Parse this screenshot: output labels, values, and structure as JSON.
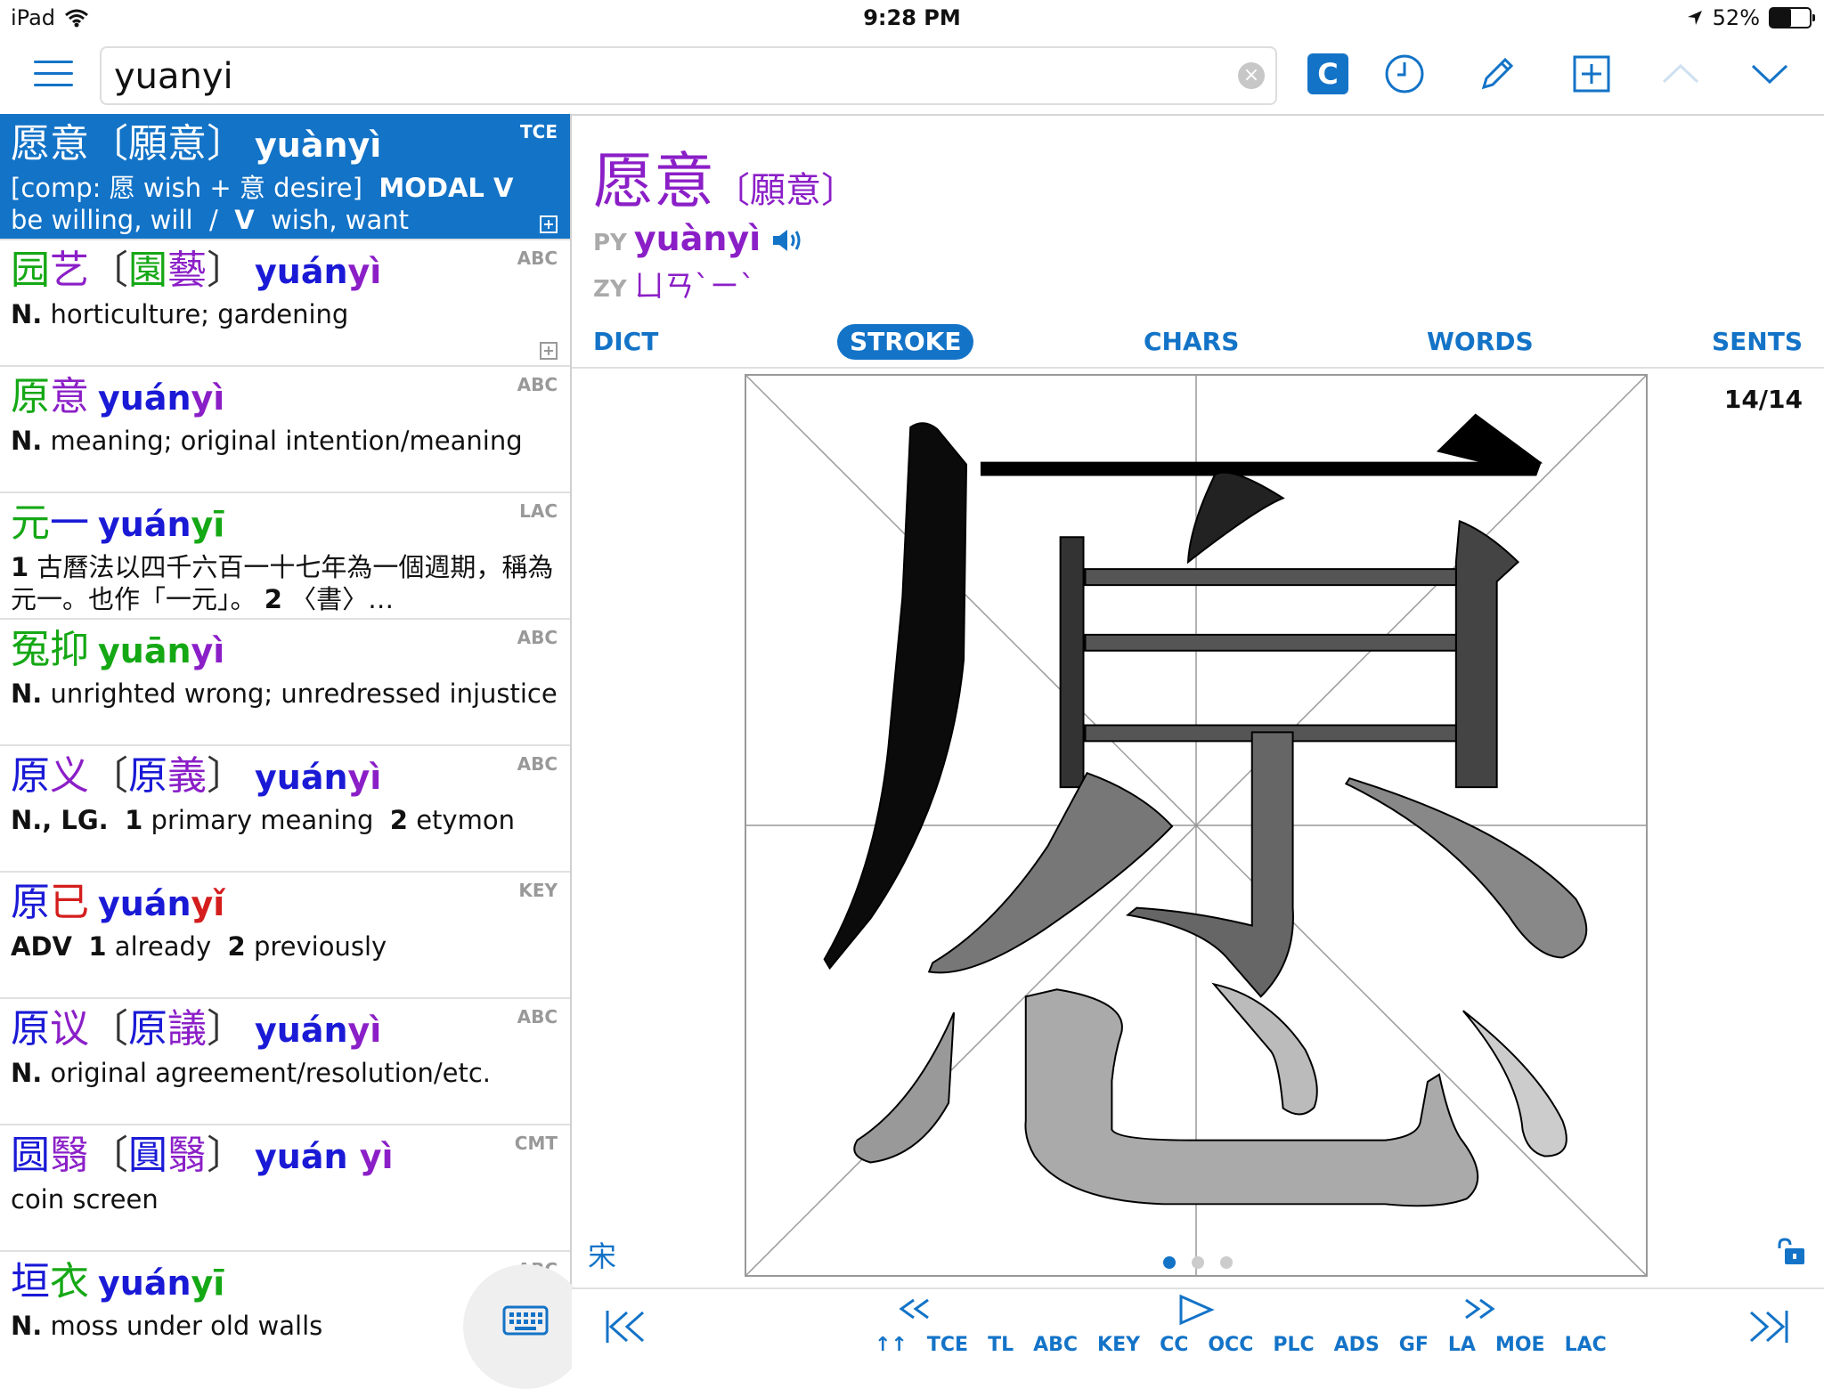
{
  "status": {
    "device": "iPad",
    "time": "9:28 PM",
    "battery": "52%",
    "battery_level": 0.52
  },
  "search": {
    "value": "yuanyi"
  },
  "toolbar": {
    "c_label": "C"
  },
  "results": [
    {
      "hanzi": [
        {
          "t": "愿意",
          "tone": "t4"
        },
        {
          "t": "〔願意〕",
          "tone": "t4"
        }
      ],
      "pinyin": [
        {
          "t": "yuànyì",
          "tone": "t4"
        }
      ],
      "source": "TCE",
      "def_html": "[comp: 愿 wish + 意 desire]&nbsp; <b>MODAL V</b>&nbsp; be willing, will&nbsp; /&nbsp; <b>V</b>&nbsp; wish, want",
      "selected": true
    },
    {
      "hanzi": [
        {
          "t": "园",
          "tone": "t2"
        },
        {
          "t": "艺",
          "tone": "t4"
        },
        {
          "t": "〔",
          "tone": "t5"
        },
        {
          "t": "園",
          "tone": "t2"
        },
        {
          "t": "藝",
          "tone": "t4"
        },
        {
          "t": "〕",
          "tone": "t5"
        }
      ],
      "pinyin": [
        {
          "t": "yuán",
          "tone": "t1"
        },
        {
          "t": "yì",
          "tone": "t4"
        }
      ],
      "source": "ABC",
      "def_html": "<b>N.</b> horticulture; gardening"
    },
    {
      "hanzi": [
        {
          "t": "原",
          "tone": "t2"
        },
        {
          "t": "意",
          "tone": "t4"
        }
      ],
      "pinyin": [
        {
          "t": "yuán",
          "tone": "t1"
        },
        {
          "t": "yì",
          "tone": "t4"
        }
      ],
      "source": "ABC",
      "def_html": "<b>N.</b> meaning; original intention/meaning"
    },
    {
      "hanzi": [
        {
          "t": "元",
          "tone": "t2"
        },
        {
          "t": "一",
          "tone": "t1"
        }
      ],
      "pinyin": [
        {
          "t": "yuán",
          "tone": "t1"
        },
        {
          "t": "yī",
          "tone": "t2"
        }
      ],
      "source": "LAC",
      "def_html": "<b>1</b> 古曆法以四千六百一十七年為一個週期，稱為元一。也作「一元」。 <b>2</b> 〈書〉…"
    },
    {
      "hanzi": [
        {
          "t": "冤",
          "tone": "t2"
        },
        {
          "t": "抑",
          "tone": "t2"
        }
      ],
      "pinyin": [
        {
          "t": "yuān",
          "tone": "t2"
        },
        {
          "t": "yì",
          "tone": "t4"
        }
      ],
      "source": "ABC",
      "def_html": "<b>N.</b> unrighted wrong; unredressed injustice"
    },
    {
      "hanzi": [
        {
          "t": "原",
          "tone": "t1"
        },
        {
          "t": "义",
          "tone": "t4"
        },
        {
          "t": "〔",
          "tone": "t5"
        },
        {
          "t": "原",
          "tone": "t1"
        },
        {
          "t": "義",
          "tone": "t4"
        },
        {
          "t": "〕",
          "tone": "t5"
        }
      ],
      "pinyin": [
        {
          "t": "yuán",
          "tone": "t1"
        },
        {
          "t": "yì",
          "tone": "t4"
        }
      ],
      "source": "ABC",
      "def_html": "<b>N., LG.</b>&nbsp; <b>1</b> primary meaning&nbsp; <b>2</b> etymon"
    },
    {
      "hanzi": [
        {
          "t": "原",
          "tone": "t1"
        },
        {
          "t": "已",
          "tone": "t3"
        }
      ],
      "pinyin": [
        {
          "t": "yuán",
          "tone": "t1"
        },
        {
          "t": "yǐ",
          "tone": "t3"
        }
      ],
      "source": "KEY",
      "def_html": "<b>ADV</b>&nbsp; <b>1</b> already&nbsp; <b>2</b> previously"
    },
    {
      "hanzi": [
        {
          "t": "原",
          "tone": "t1"
        },
        {
          "t": "议",
          "tone": "t4"
        },
        {
          "t": "〔",
          "tone": "t5"
        },
        {
          "t": "原",
          "tone": "t1"
        },
        {
          "t": "議",
          "tone": "t4"
        },
        {
          "t": "〕",
          "tone": "t5"
        }
      ],
      "pinyin": [
        {
          "t": "yuán",
          "tone": "t1"
        },
        {
          "t": "yì",
          "tone": "t4"
        }
      ],
      "source": "ABC",
      "def_html": "<b>N.</b> original agreement/resolution/etc."
    },
    {
      "hanzi": [
        {
          "t": "圆",
          "tone": "t1"
        },
        {
          "t": "翳",
          "tone": "t4"
        },
        {
          "t": "〔",
          "tone": "t5"
        },
        {
          "t": "圓",
          "tone": "t1"
        },
        {
          "t": "翳",
          "tone": "t4"
        },
        {
          "t": "〕",
          "tone": "t5"
        }
      ],
      "pinyin": [
        {
          "t": "yuán",
          "tone": "t1"
        },
        {
          "t": " yì",
          "tone": "t4"
        }
      ],
      "source": "CMT",
      "def_html": "coin screen"
    },
    {
      "hanzi": [
        {
          "t": "垣",
          "tone": "t1"
        },
        {
          "t": "衣",
          "tone": "t2"
        }
      ],
      "pinyin": [
        {
          "t": "yuán",
          "tone": "t1"
        },
        {
          "t": "yī",
          "tone": "t2"
        }
      ],
      "source": "ABC",
      "def_html": "<b>N.</b> moss under old walls"
    }
  ],
  "detail": {
    "headword": "愿意",
    "traditional": "〔願意〕",
    "py_label": "PY",
    "pinyin": "yuànyì",
    "zy_label": "ZY",
    "zhuyin": "ㄩㄢˋㄧˋ",
    "tabs": [
      "DICT",
      "STROKE",
      "CHARS",
      "WORDS",
      "SENTS"
    ],
    "active_tab": "STROKE",
    "stroke_counter": "14/14",
    "font_label": "宋"
  },
  "sources": [
    "TCE",
    "TL",
    "ABC",
    "KEY",
    "CC",
    "OCC",
    "PLC",
    "ADS",
    "GF",
    "LA",
    "MOE",
    "LAC"
  ],
  "colors": {
    "accent": "#1373c7",
    "tone1": "#1a1ad6",
    "tone2": "#15a815",
    "tone3": "#d41d1d",
    "tone4": "#8b1fc7"
  }
}
